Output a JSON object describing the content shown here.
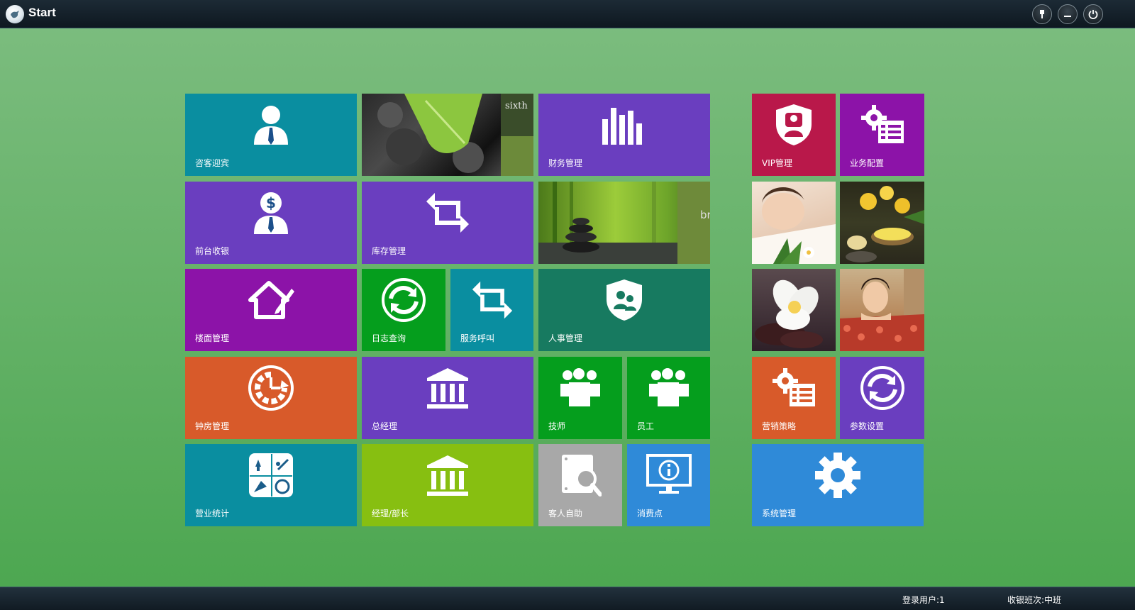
{
  "window": {
    "title": "Start",
    "buttons": [
      "pin",
      "minimize",
      "power"
    ]
  },
  "tiles": {
    "reception": {
      "label": "咨客迎宾",
      "color": "#0a8ea0",
      "icon": "person-tie-icon"
    },
    "photo_leaf": {
      "caption": "sixth"
    },
    "finance": {
      "label": "财务管理",
      "color": "#6a3ebf",
      "icon": "bar-chart-icon"
    },
    "cashier": {
      "label": "前台收银",
      "color": "#6a3ebf",
      "icon": "person-dollar-icon"
    },
    "inventory": {
      "label": "库存管理",
      "color": "#6a3ebf",
      "icon": "swap-arrows-icon"
    },
    "photo_bamboo": {
      "caption": "br"
    },
    "floor": {
      "label": "楼面管理",
      "color": "#8c13a8",
      "icon": "house-pencil-icon"
    },
    "logs": {
      "label": "日志查询",
      "color": "#059e1d",
      "icon": "refresh-icon"
    },
    "service_call": {
      "label": "服务呼叫",
      "color": "#0a8ea0",
      "icon": "swap-arrows-icon"
    },
    "hr": {
      "label": "人事管理",
      "color": "#177a60",
      "icon": "shield-users-icon"
    },
    "clock_room": {
      "label": "钟房管理",
      "color": "#d85a2a",
      "icon": "clock-cycle-icon"
    },
    "gm": {
      "label": "总经理",
      "color": "#6a3ebf",
      "icon": "bank-building-icon"
    },
    "technician": {
      "label": "技师",
      "color": "#059e1d",
      "icon": "users-group-icon"
    },
    "staff": {
      "label": "员工",
      "color": "#059e1d",
      "icon": "users-group-icon"
    },
    "business_stats": {
      "label": "营业统计",
      "color": "#0a8ea0",
      "icon": "stats-grid-icon"
    },
    "manager": {
      "label": "经理/部长",
      "color": "#87bf11",
      "icon": "bank-building-icon"
    },
    "self_service": {
      "label": "客人自助",
      "color": "#a8a8a8",
      "icon": "magnifier-doc-icon"
    },
    "consumption_point": {
      "label": "消费点",
      "color": "#2f8ad8",
      "icon": "monitor-info-icon"
    },
    "vip": {
      "label": "VIP管理",
      "color": "#b9184a",
      "icon": "shield-user-icon"
    },
    "business_config": {
      "label": "业务配置",
      "color": "#8c13a8",
      "icon": "gear-list-icon"
    },
    "marketing": {
      "label": "营销策略",
      "color": "#d85a2a",
      "icon": "gear-list-icon"
    },
    "params": {
      "label": "参数设置",
      "color": "#6a3ebf",
      "icon": "refresh-icon"
    },
    "system": {
      "label": "系统管理",
      "color": "#2f8ad8",
      "icon": "gear-icon"
    }
  },
  "status": {
    "login_user": "登录用户:1",
    "shift": "收银班次:中班"
  }
}
